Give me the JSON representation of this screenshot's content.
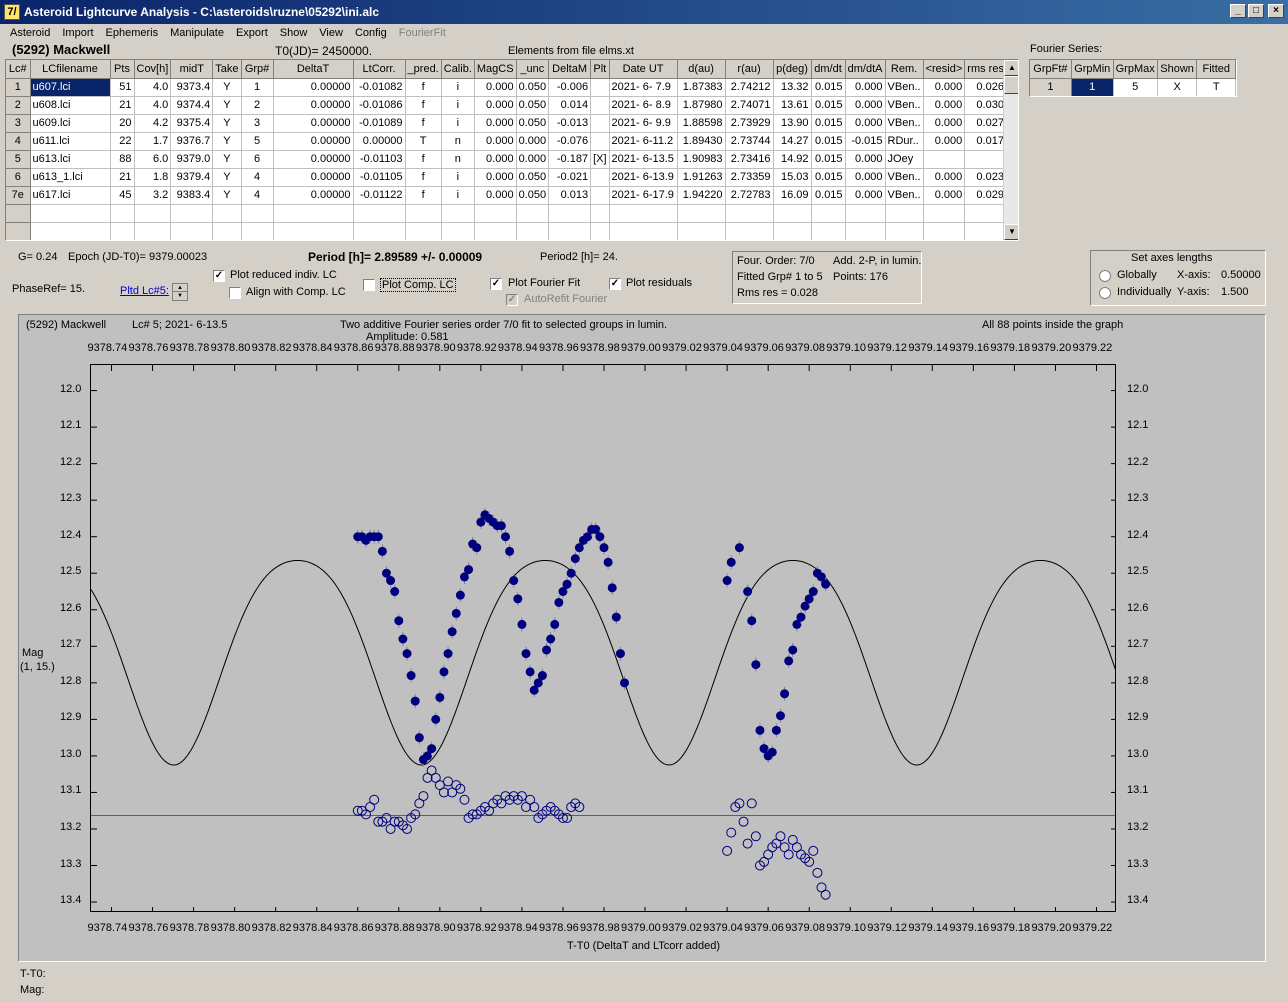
{
  "window": {
    "title": "Asteroid Lightcurve Analysis - C:\\asteroids\\ruzne\\05292\\ini.alc",
    "app_icon": "7/"
  },
  "menu": [
    {
      "label": "Asteroid"
    },
    {
      "label": "Import"
    },
    {
      "label": "Ephemeris"
    },
    {
      "label": "Manipulate"
    },
    {
      "label": "Export"
    },
    {
      "label": "Show"
    },
    {
      "label": "View"
    },
    {
      "label": "Config"
    },
    {
      "label": "FourierFit",
      "disabled": true
    }
  ],
  "header": {
    "asteroid_name": "(5292) Mackwell",
    "t0": "T0(JD)= 2450000.",
    "elements_source": "Elements from file elms.xt",
    "fourier_series_label": "Fourier Series:"
  },
  "lc_table": {
    "columns": [
      "Lc#",
      "LCfilename",
      "Pts",
      "Cov[h]",
      "midT",
      "Take",
      "Grp#",
      "DeltaT",
      "LtCorr.",
      "_pred.",
      "Calib.",
      "MagCS",
      "_unc",
      "DeltaM",
      "Plt",
      "Date UT",
      "d(au)",
      "r(au)",
      "p(deg)",
      "dm/dt",
      "dm/dtA",
      "Rem.",
      "<resid>",
      "rms res"
    ],
    "rows": [
      [
        "1",
        "u607.lci",
        "51",
        "4.0",
        "9373.4",
        "Y",
        "1",
        "0.00000",
        "-0.01082",
        "f",
        "i",
        "0.000",
        "0.050",
        "-0.006",
        "",
        "2021- 6- 7.9",
        "1.87383",
        "2.74212",
        "13.32",
        "0.015",
        "0.000",
        "VBen..",
        "0.000",
        "0.026"
      ],
      [
        "2",
        "u608.lci",
        "21",
        "4.0",
        "9374.4",
        "Y",
        "2",
        "0.00000",
        "-0.01086",
        "f",
        "i",
        "0.000",
        "0.050",
        "0.014",
        "",
        "2021- 6- 8.9",
        "1.87980",
        "2.74071",
        "13.61",
        "0.015",
        "0.000",
        "VBen..",
        "0.000",
        "0.030"
      ],
      [
        "3",
        "u609.lci",
        "20",
        "4.2",
        "9375.4",
        "Y",
        "3",
        "0.00000",
        "-0.01089",
        "f",
        "i",
        "0.000",
        "0.050",
        "-0.013",
        "",
        "2021- 6- 9.9",
        "1.88598",
        "2.73929",
        "13.90",
        "0.015",
        "0.000",
        "VBen..",
        "0.000",
        "0.027"
      ],
      [
        "4",
        "u611.lci",
        "22",
        "1.7",
        "9376.7",
        "Y",
        "5",
        "0.00000",
        "0.00000",
        "T",
        "n",
        "0.000",
        "0.000",
        "-0.076",
        "",
        "2021- 6-11.2",
        "1.89430",
        "2.73744",
        "14.27",
        "0.015",
        "-0.015",
        "RDur..",
        "0.000",
        "0.017"
      ],
      [
        "5",
        "u613.lci",
        "88",
        "6.0",
        "9379.0",
        "Y",
        "6",
        "0.00000",
        "-0.01103",
        "f",
        "n",
        "0.000",
        "0.000",
        "-0.187",
        "[X]",
        "2021- 6-13.5",
        "1.90983",
        "2.73416",
        "14.92",
        "0.015",
        "0.000",
        "JOey",
        "",
        ""
      ],
      [
        "6",
        "u613_1.lci",
        "21",
        "1.8",
        "9379.4",
        "Y",
        "4",
        "0.00000",
        "-0.01105",
        "f",
        "i",
        "0.000",
        "0.050",
        "-0.021",
        "",
        "2021- 6-13.9",
        "1.91263",
        "2.73359",
        "15.03",
        "0.015",
        "0.000",
        "VBen..",
        "0.000",
        "0.023"
      ],
      [
        "7e",
        "u617.lci",
        "45",
        "3.2",
        "9383.4",
        "Y",
        "4",
        "0.00000",
        "-0.01122",
        "f",
        "i",
        "0.000",
        "0.050",
        "0.013",
        "",
        "2021- 6-17.9",
        "1.94220",
        "2.72783",
        "16.09",
        "0.015",
        "0.000",
        "VBen..",
        "0.000",
        "0.029"
      ],
      [
        "",
        "",
        "",
        "",
        "",
        "",
        "",
        "",
        "",
        "",
        "",
        "",
        "",
        "",
        "",
        "",
        "",
        "",
        "",
        "",
        "",
        "",
        "",
        ""
      ],
      [
        "",
        "",
        "",
        "",
        "",
        "",
        "",
        "",
        "",
        "",
        "",
        "",
        "",
        "",
        "",
        "",
        "",
        "",
        "",
        "",
        "",
        "",
        "",
        ""
      ]
    ]
  },
  "fourier_table": {
    "columns": [
      "GrpFt#",
      "GrpMin",
      "GrpMax",
      "Shown",
      "Fitted"
    ],
    "rows": [
      [
        "1",
        "1",
        "5",
        "X",
        "T"
      ]
    ]
  },
  "controls": {
    "g": "G= 0.24",
    "epoch": "Epoch (JD-T0)= 9379.00023",
    "period": "Period [h]= 2.89589 +/- 0.00009",
    "period2": "Period2 [h]= 24.",
    "phaseref": "PhaseRef= 15.",
    "pltd_lc": "Pltd Lc#5:",
    "plot_reduced": {
      "label": "Plot reduced indiv. LC",
      "checked": true
    },
    "align_comp": {
      "label": "Align with Comp. LC",
      "checked": false
    },
    "plot_comp": {
      "label": "Plot Comp. LC",
      "checked": false
    },
    "plot_fourier": {
      "label": "Plot Fourier Fit",
      "checked": true
    },
    "autorefit": {
      "label": "AutoRefit Fourier",
      "checked": true,
      "disabled": true
    },
    "plot_residuals": {
      "label": "Plot residuals",
      "checked": true
    }
  },
  "fit_info": {
    "order": "Four. Order:  7/0",
    "add": "Add. 2-P, in lumin.",
    "fitted": "Fitted Grp# 1 to 5",
    "points": "Points: 176",
    "rms": "Rms res      = 0.028"
  },
  "axes_panel": {
    "title": "Set axes lengths",
    "globally": "Globally",
    "individually": "Individually",
    "x_label": "X-axis:",
    "x_value": "0.50000",
    "y_label": "Y-axis:",
    "y_value": "1.500"
  },
  "graph": {
    "name": "(5292) Mackwell",
    "lc": "Lc# 5; 2021- 6-13.5",
    "desc": "Two additive Fourier series order 7/0 fit to selected groups in lumin.",
    "amplitude": "Amplitude: 0.581",
    "inside": "All 88 points inside the graph",
    "ylabel1": "Mag",
    "ylabel2": "(1, 15.)",
    "xlabel": "T-T0 (DeltaT and LTcorr added)",
    "x_ticks": [
      "9378.74",
      "9378.76",
      "9378.78",
      "9378.80",
      "9378.82",
      "9378.84",
      "9378.86",
      "9378.88",
      "9378.90",
      "9378.92",
      "9378.94",
      "9378.96",
      "9378.98",
      "9379.00",
      "9379.02",
      "9379.04",
      "9379.06",
      "9379.08",
      "9379.10",
      "9379.12",
      "9379.14",
      "9379.16",
      "9379.18",
      "9379.20",
      "9379.22"
    ],
    "y_ticks": [
      "12.0",
      "12.1",
      "12.2",
      "12.3",
      "12.4",
      "12.5",
      "12.6",
      "12.7",
      "12.8",
      "12.9",
      "13.0",
      "13.1",
      "13.2",
      "13.3",
      "13.4"
    ]
  },
  "chart_data": {
    "type": "scatter",
    "x_range": [
      9378.73,
      9379.23
    ],
    "y_range": [
      11.93,
      13.43
    ],
    "y_inverted": true,
    "residual_baseline": 13.163,
    "series": [
      {
        "kind": "observed",
        "color": "#00007f",
        "points": [
          [
            9378.86,
            12.4
          ],
          [
            9378.862,
            12.4
          ],
          [
            9378.864,
            12.41
          ],
          [
            9378.866,
            12.4
          ],
          [
            9378.868,
            12.4
          ],
          [
            9378.87,
            12.4
          ],
          [
            9378.872,
            12.44
          ],
          [
            9378.874,
            12.5
          ],
          [
            9378.876,
            12.52
          ],
          [
            9378.878,
            12.55
          ],
          [
            9378.88,
            12.63
          ],
          [
            9378.882,
            12.68
          ],
          [
            9378.884,
            12.72
          ],
          [
            9378.886,
            12.78
          ],
          [
            9378.888,
            12.85
          ],
          [
            9378.89,
            12.95
          ],
          [
            9378.892,
            13.01
          ],
          [
            9378.894,
            13.0
          ],
          [
            9378.896,
            12.98
          ],
          [
            9378.898,
            12.9
          ],
          [
            9378.9,
            12.84
          ],
          [
            9378.902,
            12.77
          ],
          [
            9378.904,
            12.72
          ],
          [
            9378.906,
            12.66
          ],
          [
            9378.908,
            12.61
          ],
          [
            9378.91,
            12.56
          ],
          [
            9378.912,
            12.51
          ],
          [
            9378.914,
            12.49
          ],
          [
            9378.916,
            12.42
          ],
          [
            9378.918,
            12.43
          ],
          [
            9378.92,
            12.36
          ],
          [
            9378.922,
            12.34
          ],
          [
            9378.924,
            12.35
          ],
          [
            9378.926,
            12.36
          ],
          [
            9378.928,
            12.37
          ],
          [
            9378.93,
            12.37
          ],
          [
            9378.932,
            12.4
          ],
          [
            9378.934,
            12.44
          ],
          [
            9378.936,
            12.52
          ],
          [
            9378.938,
            12.57
          ],
          [
            9378.94,
            12.64
          ],
          [
            9378.942,
            12.72
          ],
          [
            9378.944,
            12.77
          ],
          [
            9378.946,
            12.82
          ],
          [
            9378.948,
            12.8
          ],
          [
            9378.95,
            12.78
          ],
          [
            9378.952,
            12.71
          ],
          [
            9378.954,
            12.68
          ],
          [
            9378.956,
            12.64
          ],
          [
            9378.958,
            12.58
          ],
          [
            9378.96,
            12.55
          ],
          [
            9378.962,
            12.53
          ],
          [
            9378.964,
            12.5
          ],
          [
            9378.966,
            12.46
          ],
          [
            9378.968,
            12.43
          ],
          [
            9378.97,
            12.41
          ],
          [
            9378.972,
            12.4
          ],
          [
            9378.974,
            12.38
          ],
          [
            9378.976,
            12.38
          ],
          [
            9378.978,
            12.4
          ],
          [
            9378.98,
            12.43
          ],
          [
            9378.982,
            12.47
          ],
          [
            9378.984,
            12.54
          ],
          [
            9378.986,
            12.62
          ],
          [
            9378.988,
            12.72
          ],
          [
            9378.99,
            12.8
          ],
          [
            9379.04,
            12.52
          ],
          [
            9379.042,
            12.47
          ],
          [
            9379.046,
            12.43
          ],
          [
            9379.05,
            12.55
          ],
          [
            9379.052,
            12.63
          ],
          [
            9379.054,
            12.75
          ],
          [
            9379.056,
            12.93
          ],
          [
            9379.058,
            12.98
          ],
          [
            9379.06,
            13.0
          ],
          [
            9379.062,
            12.99
          ],
          [
            9379.064,
            12.93
          ],
          [
            9379.066,
            12.89
          ],
          [
            9379.068,
            12.83
          ],
          [
            9379.07,
            12.74
          ],
          [
            9379.072,
            12.71
          ],
          [
            9379.074,
            12.64
          ],
          [
            9379.076,
            12.62
          ],
          [
            9379.078,
            12.59
          ],
          [
            9379.08,
            12.57
          ],
          [
            9379.082,
            12.55
          ],
          [
            9379.084,
            12.5
          ],
          [
            9379.086,
            12.51
          ],
          [
            9379.088,
            12.53
          ]
        ]
      },
      {
        "kind": "residuals",
        "color": "#00007f",
        "points": [
          [
            9378.86,
            13.15
          ],
          [
            9378.862,
            13.15
          ],
          [
            9378.864,
            13.16
          ],
          [
            9378.866,
            13.14
          ],
          [
            9378.868,
            13.12
          ],
          [
            9378.87,
            13.18
          ],
          [
            9378.872,
            13.18
          ],
          [
            9378.874,
            13.17
          ],
          [
            9378.876,
            13.2
          ],
          [
            9378.878,
            13.18
          ],
          [
            9378.88,
            13.18
          ],
          [
            9378.882,
            13.19
          ],
          [
            9378.884,
            13.2
          ],
          [
            9378.886,
            13.17
          ],
          [
            9378.888,
            13.16
          ],
          [
            9378.89,
            13.13
          ],
          [
            9378.892,
            13.11
          ],
          [
            9378.894,
            13.06
          ],
          [
            9378.896,
            13.04
          ],
          [
            9378.898,
            13.06
          ],
          [
            9378.9,
            13.08
          ],
          [
            9378.902,
            13.1
          ],
          [
            9378.904,
            13.07
          ],
          [
            9378.906,
            13.1
          ],
          [
            9378.908,
            13.08
          ],
          [
            9378.91,
            13.09
          ],
          [
            9378.912,
            13.12
          ],
          [
            9378.914,
            13.17
          ],
          [
            9378.916,
            13.16
          ],
          [
            9378.918,
            13.16
          ],
          [
            9378.92,
            13.15
          ],
          [
            9378.922,
            13.14
          ],
          [
            9378.924,
            13.15
          ],
          [
            9378.926,
            13.13
          ],
          [
            9378.928,
            13.12
          ],
          [
            9378.93,
            13.13
          ],
          [
            9378.932,
            13.11
          ],
          [
            9378.934,
            13.12
          ],
          [
            9378.936,
            13.11
          ],
          [
            9378.938,
            13.12
          ],
          [
            9378.94,
            13.11
          ],
          [
            9378.942,
            13.14
          ],
          [
            9378.944,
            13.12
          ],
          [
            9378.946,
            13.14
          ],
          [
            9378.948,
            13.17
          ],
          [
            9378.95,
            13.16
          ],
          [
            9378.952,
            13.15
          ],
          [
            9378.954,
            13.14
          ],
          [
            9378.956,
            13.15
          ],
          [
            9378.958,
            13.16
          ],
          [
            9378.96,
            13.17
          ],
          [
            9378.962,
            13.17
          ],
          [
            9378.964,
            13.14
          ],
          [
            9378.966,
            13.13
          ],
          [
            9378.968,
            13.14
          ],
          [
            9379.04,
            13.26
          ],
          [
            9379.042,
            13.21
          ],
          [
            9379.044,
            13.14
          ],
          [
            9379.046,
            13.13
          ],
          [
            9379.048,
            13.18
          ],
          [
            9379.05,
            13.24
          ],
          [
            9379.052,
            13.13
          ],
          [
            9379.054,
            13.22
          ],
          [
            9379.056,
            13.3
          ],
          [
            9379.058,
            13.29
          ],
          [
            9379.06,
            13.27
          ],
          [
            9379.062,
            13.25
          ],
          [
            9379.064,
            13.24
          ],
          [
            9379.066,
            13.22
          ],
          [
            9379.068,
            13.25
          ],
          [
            9379.07,
            13.27
          ],
          [
            9379.072,
            13.23
          ],
          [
            9379.074,
            13.25
          ],
          [
            9379.076,
            13.27
          ],
          [
            9379.078,
            13.28
          ],
          [
            9379.08,
            13.29
          ],
          [
            9379.082,
            13.26
          ],
          [
            9379.084,
            13.32
          ],
          [
            9379.086,
            13.36
          ],
          [
            9379.088,
            13.38
          ]
        ]
      }
    ],
    "fit_curve": {
      "kind": "fourier",
      "period_days": 0.1207,
      "mean": 12.705,
      "amp": 0.28,
      "min_phase": 9378.891
    }
  }
}
